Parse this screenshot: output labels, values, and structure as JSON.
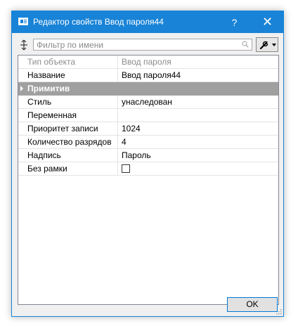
{
  "window": {
    "title": "Редактор свойств Ввод пароля44",
    "help_label": "?",
    "close_label": "✕",
    "accent_color": "#1883d7"
  },
  "toolbar": {
    "sort_icon": "sort-arrows-icon",
    "filter_placeholder": "Фильтр по имени",
    "filter_value": "",
    "search_icon": "search-icon",
    "tools_icon": "wrench-icon"
  },
  "properties": {
    "object_type": {
      "label": "Тип объекта",
      "value": "Ввод пароля"
    },
    "name": {
      "label": "Название",
      "value": "Ввод пароля44"
    },
    "category": {
      "label": "Примитив"
    },
    "style": {
      "label": "Стиль",
      "value": "унаследован"
    },
    "variable": {
      "label": "Переменная",
      "value": ""
    },
    "priority": {
      "label": "Приоритет записи",
      "value": "1024"
    },
    "digits": {
      "label": "Количество разрядов",
      "value": "4"
    },
    "caption": {
      "label": "Надпись",
      "value": "Пароль"
    },
    "no_frame": {
      "label": "Без рамки",
      "checked": false
    }
  },
  "footer": {
    "ok_label": "OK"
  }
}
